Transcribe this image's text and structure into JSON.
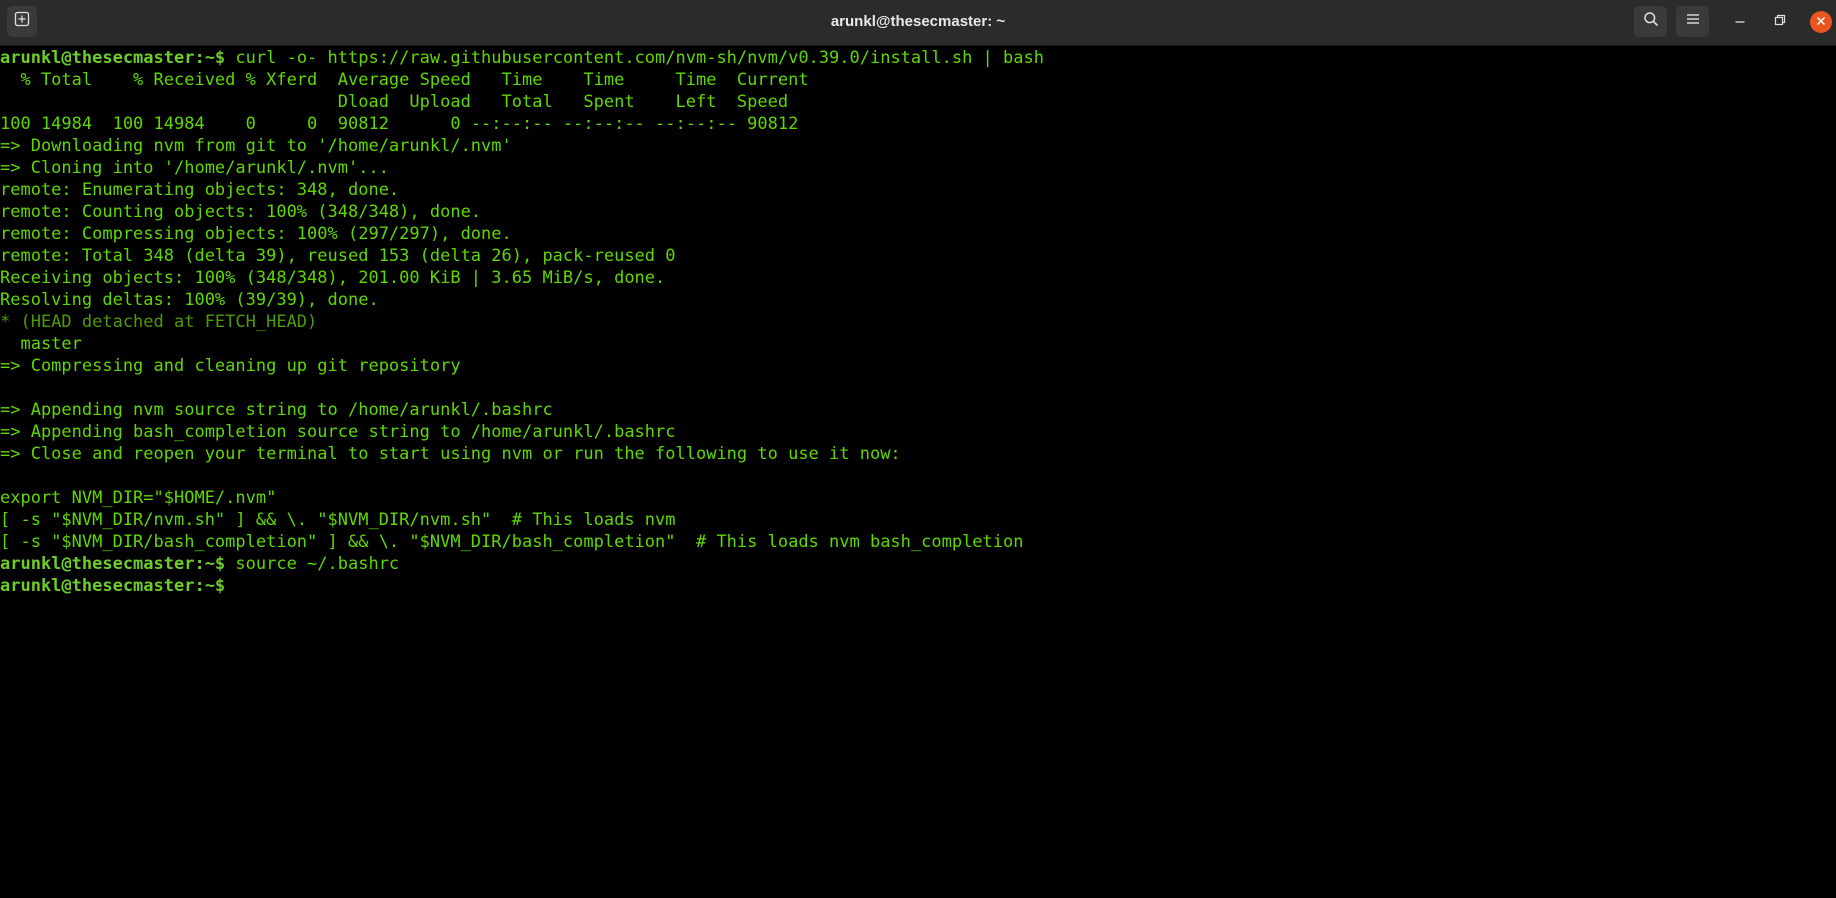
{
  "window": {
    "title": "arunkl@thesecmaster: ~"
  },
  "colors": {
    "titlebar_bg": "#2b2b2b",
    "terminal_bg": "#000000",
    "terminal_fg": "#5fd700",
    "close_button": "#e95420"
  },
  "icons": {
    "new_tab": "new-tab-icon",
    "search": "search-icon",
    "menu": "hamburger-menu-icon",
    "minimize": "minimize-icon",
    "restore": "restore-icon",
    "close": "close-icon"
  },
  "terminal": {
    "prompt": "arunkl@thesecmaster:~$",
    "lines": [
      {
        "prompt": "arunkl@thesecmaster:~$",
        "text": " curl -o- https://raw.githubusercontent.com/nvm-sh/nvm/v0.39.0/install.sh | bash"
      },
      {
        "text": "  % Total    % Received % Xferd  Average Speed   Time    Time     Time  Current"
      },
      {
        "text": "                                 Dload  Upload   Total   Spent    Left  Speed"
      },
      {
        "text": "100 14984  100 14984    0     0  90812      0 --:--:-- --:--:-- --:--:-- 90812"
      },
      {
        "text": "=> Downloading nvm from git to '/home/arunkl/.nvm'"
      },
      {
        "text": "=> Cloning into '/home/arunkl/.nvm'..."
      },
      {
        "text": "remote: Enumerating objects: 348, done."
      },
      {
        "text": "remote: Counting objects: 100% (348/348), done."
      },
      {
        "text": "remote: Compressing objects: 100% (297/297), done."
      },
      {
        "text": "remote: Total 348 (delta 39), reused 153 (delta 26), pack-reused 0"
      },
      {
        "text": "Receiving objects: 100% (348/348), 201.00 KiB | 3.65 MiB/s, done."
      },
      {
        "text": "Resolving deltas: 100% (39/39), done."
      },
      {
        "text": "* (HEAD detached at FETCH_HEAD)",
        "dim": true
      },
      {
        "text": "  master"
      },
      {
        "text": "=> Compressing and cleaning up git repository"
      },
      {
        "text": ""
      },
      {
        "text": "=> Appending nvm source string to /home/arunkl/.bashrc"
      },
      {
        "text": "=> Appending bash_completion source string to /home/arunkl/.bashrc"
      },
      {
        "text": "=> Close and reopen your terminal to start using nvm or run the following to use it now:"
      },
      {
        "text": ""
      },
      {
        "text": "export NVM_DIR=\"$HOME/.nvm\""
      },
      {
        "text": "[ -s \"$NVM_DIR/nvm.sh\" ] && \\. \"$NVM_DIR/nvm.sh\"  # This loads nvm"
      },
      {
        "text": "[ -s \"$NVM_DIR/bash_completion\" ] && \\. \"$NVM_DIR/bash_completion\"  # This loads nvm bash_completion"
      },
      {
        "prompt": "arunkl@thesecmaster:~$",
        "text": " source ~/.bashrc"
      },
      {
        "prompt": "arunkl@thesecmaster:~$",
        "text": ""
      }
    ]
  }
}
